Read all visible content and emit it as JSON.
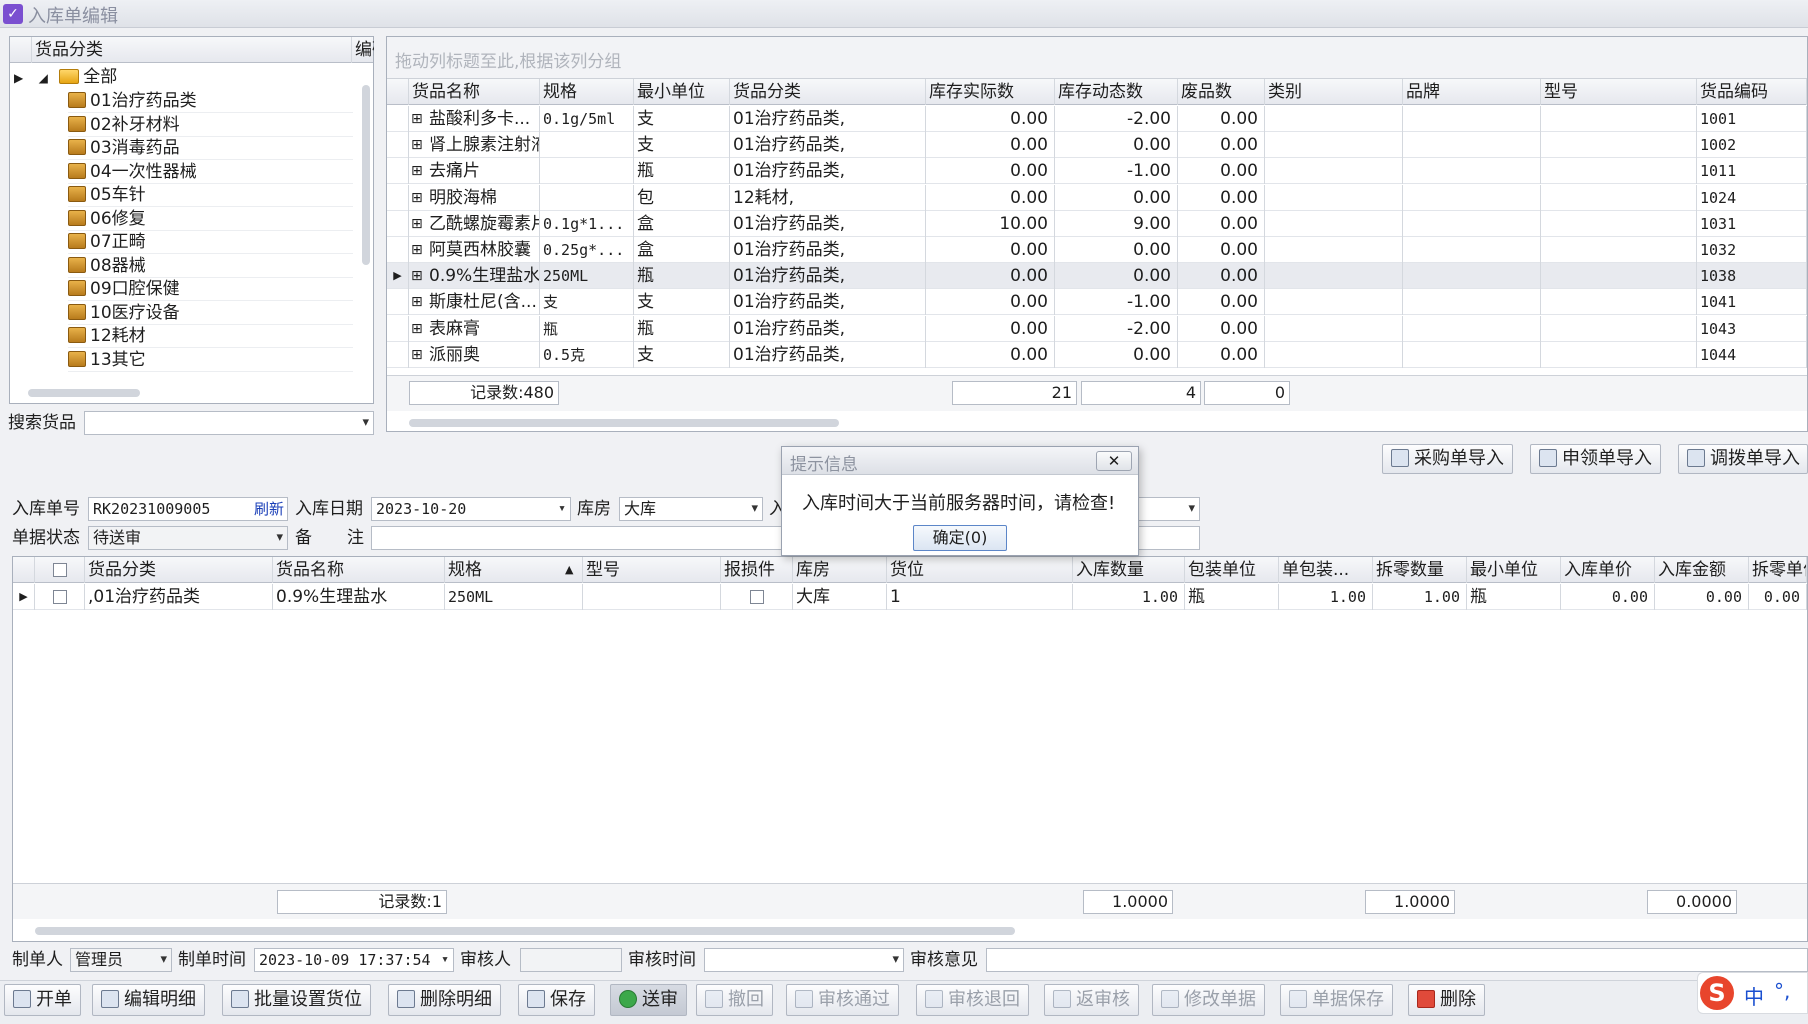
{
  "window": {
    "title": "入库单编辑"
  },
  "tree": {
    "col_header": "货品分类",
    "col_header2": "编码",
    "root": "全部",
    "items": [
      "01治疗药品类",
      "02补牙材料",
      "03消毒药品",
      "04一次性器械",
      "05车针",
      "06修复",
      "07正畸",
      "08器械",
      "09口腔保健",
      "10医疗设备",
      "12耗材",
      "13其它"
    ]
  },
  "search": {
    "label": "搜索货品"
  },
  "grid": {
    "group_hint": "拖动列标题至此,根据该列分组",
    "headers": [
      "货品名称",
      "规格",
      "最小单位",
      "货品分类",
      "库存实际数",
      "库存动态数",
      "废品数",
      "类别",
      "品牌",
      "型号",
      "货品编码"
    ],
    "rows": [
      [
        "盐酸利多卡...",
        "0.1g/5ml",
        "支",
        "01治疗药品类,",
        "0.00",
        "-2.00",
        "0.00",
        "",
        "",
        "",
        "1001"
      ],
      [
        "肾上腺素注射液",
        "",
        "支",
        "01治疗药品类,",
        "0.00",
        "0.00",
        "0.00",
        "",
        "",
        "",
        "1002"
      ],
      [
        "去痛片",
        "",
        "瓶",
        "01治疗药品类,",
        "0.00",
        "-1.00",
        "0.00",
        "",
        "",
        "",
        "1011"
      ],
      [
        "明胶海棉",
        "",
        "包",
        "12耗材,",
        "0.00",
        "0.00",
        "0.00",
        "",
        "",
        "",
        "1024"
      ],
      [
        "乙酰螺旋霉素片",
        "0.1g*1...",
        "盒",
        "01治疗药品类,",
        "10.00",
        "9.00",
        "0.00",
        "",
        "",
        "",
        "1031"
      ],
      [
        "阿莫西林胶囊",
        "0.25g*...",
        "盒",
        "01治疗药品类,",
        "0.00",
        "0.00",
        "0.00",
        "",
        "",
        "",
        "1032"
      ],
      [
        "0.9%生理盐水",
        "250ML",
        "瓶",
        "01治疗药品类,",
        "0.00",
        "0.00",
        "0.00",
        "",
        "",
        "",
        "1038"
      ],
      [
        "斯康杜尼(含...",
        "支",
        "支",
        "01治疗药品类,",
        "0.00",
        "-1.00",
        "0.00",
        "",
        "",
        "",
        "1041"
      ],
      [
        "表麻膏",
        "瓶",
        "瓶",
        "01治疗药品类,",
        "0.00",
        "-2.00",
        "0.00",
        "",
        "",
        "",
        "1043"
      ],
      [
        "派丽奥",
        "0.5克",
        "支",
        "01治疗药品类,",
        "0.00",
        "0.00",
        "0.00",
        "",
        "",
        "",
        "1044"
      ]
    ],
    "footer_count": "记录数:480",
    "footer_sum1": "21",
    "footer_sum2": "4",
    "footer_sum3": "0"
  },
  "import_buttons": [
    "采购单导入",
    "申领单导入",
    "调拨单导入"
  ],
  "form": {
    "order_no_label": "入库单号",
    "order_no": "RK20231009005",
    "refresh": "刷新",
    "date_label": "入库日期",
    "date": "2023-10-20",
    "warehouse_label": "库房",
    "warehouse": "大库",
    "cut_label": "入",
    "status_label": "单据状态",
    "status": "待送审",
    "remark_label1": "备",
    "remark_label2": "注"
  },
  "detail": {
    "headers": [
      "货品分类",
      "货品名称",
      "规格",
      "型号",
      "报损件",
      "入库数量",
      "包装单位",
      "单包装...",
      "拆零数量",
      "最小单位",
      "入库单价",
      "入库金额",
      "拆零单价"
    ],
    "partial_headers": [
      "库房",
      "货位"
    ],
    "row": {
      "category": ",01治疗药品类",
      "name": "0.9%生理盐水",
      "spec": "250ML",
      "model": "",
      "warehouse": "大库",
      "location": "1",
      "qty": "1.00",
      "pack_unit": "瓶",
      "per_pack": "1.00",
      "split_qty": "1.00",
      "min_unit": "瓶",
      "unit_price": "0.00",
      "amount": "0.00",
      "split_price": "0.00"
    },
    "footer_count": "记录数:1",
    "footer_sum1": "1.0000",
    "footer_sum2": "1.0000",
    "footer_sum3": "0.0000"
  },
  "audit": {
    "maker_label": "制单人",
    "maker": "管理员",
    "make_time_label": "制单时间",
    "make_time": "2023-10-09 17:37:54",
    "auditor_label": "审核人",
    "audit_time_label": "审核时间",
    "audit_opinion_label": "审核意见"
  },
  "toolbar": [
    "开单",
    "编辑明细",
    "批量设置货位",
    "删除明细",
    "保存",
    "送审",
    "撤回",
    "审核通过",
    "审核退回",
    "返审核",
    "修改单据",
    "单据保存",
    "删除"
  ],
  "dialog": {
    "title": "提示信息",
    "message": "入库时间大于当前服务器时间，请检查!",
    "ok": "确定(0)"
  },
  "ime": {
    "lang": "中",
    "punct": "°,"
  }
}
